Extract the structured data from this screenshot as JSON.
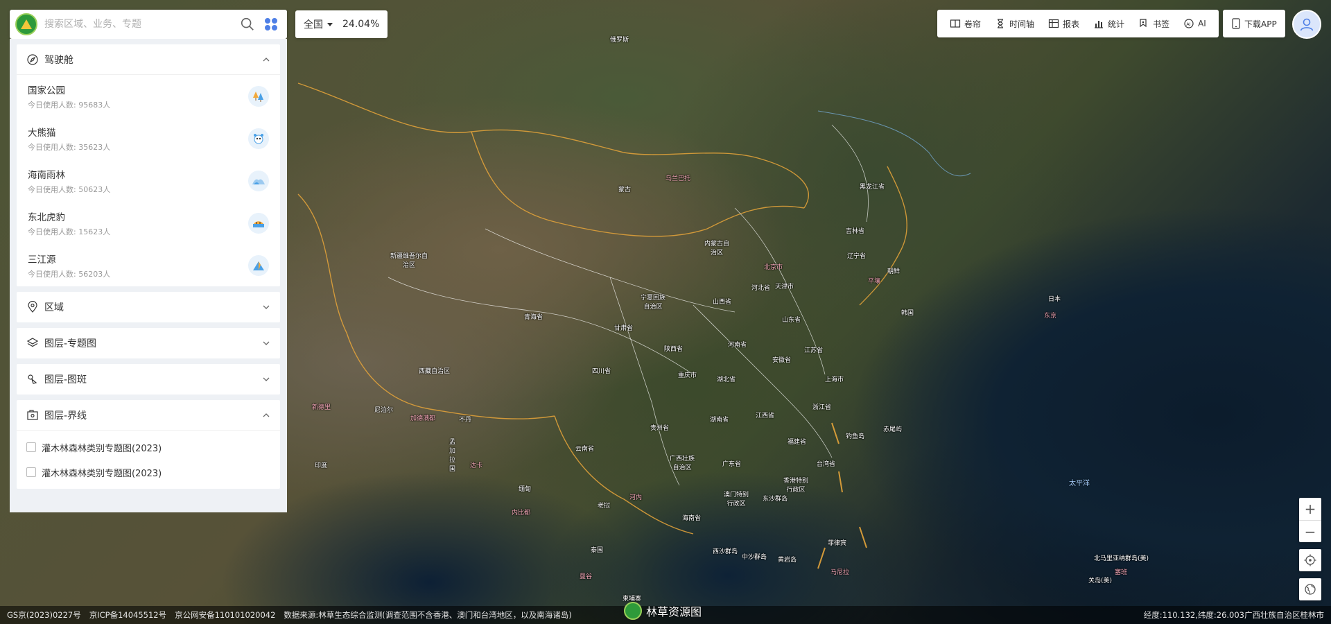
{
  "search": {
    "placeholder": "搜索区域、业务、专题"
  },
  "region_selector": {
    "value": "全国",
    "coverage": "24.04%"
  },
  "toolbar": {
    "items": [
      {
        "label": "卷帘",
        "icon": "split-screen-icon"
      },
      {
        "label": "时间轴",
        "icon": "hourglass-icon"
      },
      {
        "label": "报表",
        "icon": "table-icon"
      },
      {
        "label": "统计",
        "icon": "bar-chart-icon"
      },
      {
        "label": "书签",
        "icon": "bookmark-pin-icon"
      },
      {
        "label": "AI",
        "icon": "ai-icon"
      }
    ],
    "download_label": "下载APP"
  },
  "panel": {
    "cockpit": {
      "title": "驾驶舱",
      "items": [
        {
          "title": "国家公园",
          "sub": "今日使用人数: 95683人"
        },
        {
          "title": "大熊猫",
          "sub": "今日使用人数: 35623人"
        },
        {
          "title": "海南雨林",
          "sub": "今日使用人数: 50623人"
        },
        {
          "title": "东北虎豹",
          "sub": "今日使用人数: 15623人"
        },
        {
          "title": "三江源",
          "sub": "今日使用人数: 56203人"
        }
      ]
    },
    "region": {
      "title": "区域"
    },
    "layer_theme": {
      "title": "图层-专题图"
    },
    "layer_patch": {
      "title": "图层-图斑"
    },
    "layer_boundary": {
      "title": "图层-界线",
      "items": [
        {
          "label": "灌木林森林类别专题图(2023)"
        },
        {
          "label": "灌木林森林类别专题图(2023)"
        }
      ]
    }
  },
  "map_labels": [
    {
      "text": "俄罗斯",
      "pink": false
    },
    {
      "text": "蒙古",
      "pink": false
    },
    {
      "text": "乌兰巴托",
      "pink": true
    },
    {
      "text": "黑龙江省",
      "pink": false
    },
    {
      "text": "吉林省",
      "pink": false
    },
    {
      "text": "辽宁省",
      "pink": false
    },
    {
      "text": "朝鲜",
      "pink": false
    },
    {
      "text": "平壤",
      "pink": true
    },
    {
      "text": "韩国",
      "pink": false
    },
    {
      "text": "日本",
      "pink": false
    },
    {
      "text": "东京",
      "pink": true
    },
    {
      "text": "内蒙古自治区",
      "pink": false
    },
    {
      "text": "北京市",
      "pink": true
    },
    {
      "text": "天津市",
      "pink": false
    },
    {
      "text": "河北省",
      "pink": false
    },
    {
      "text": "山西省",
      "pink": false
    },
    {
      "text": "山东省",
      "pink": false
    },
    {
      "text": "宁夏回族自治区",
      "pink": false
    },
    {
      "text": "新疆维吾尔自治区",
      "pink": false
    },
    {
      "text": "青海省",
      "pink": false
    },
    {
      "text": "甘肃省",
      "pink": false
    },
    {
      "text": "陕西省",
      "pink": false
    },
    {
      "text": "河南省",
      "pink": false
    },
    {
      "text": "江苏省",
      "pink": false
    },
    {
      "text": "安徽省",
      "pink": false
    },
    {
      "text": "上海市",
      "pink": false
    },
    {
      "text": "西藏自治区",
      "pink": false
    },
    {
      "text": "四川省",
      "pink": false
    },
    {
      "text": "重庆市",
      "pink": false
    },
    {
      "text": "湖北省",
      "pink": false
    },
    {
      "text": "浙江省",
      "pink": false
    },
    {
      "text": "湖南省",
      "pink": false
    },
    {
      "text": "江西省",
      "pink": false
    },
    {
      "text": "贵州省",
      "pink": false
    },
    {
      "text": "福建省",
      "pink": false
    },
    {
      "text": "云南省",
      "pink": false
    },
    {
      "text": "广西壮族自治区",
      "pink": false
    },
    {
      "text": "广东省",
      "pink": false
    },
    {
      "text": "台湾省",
      "pink": false
    },
    {
      "text": "香港特别行政区",
      "pink": false
    },
    {
      "text": "澳门特别行政区",
      "pink": false
    },
    {
      "text": "海南省",
      "pink": false
    },
    {
      "text": "尼泊尔",
      "pink": false
    },
    {
      "text": "加德满都",
      "pink": true
    },
    {
      "text": "不丹",
      "pink": false
    },
    {
      "text": "印度",
      "pink": false
    },
    {
      "text": "缅甸",
      "pink": false
    },
    {
      "text": "内比都",
      "pink": true
    },
    {
      "text": "老挝",
      "pink": false
    },
    {
      "text": "河内",
      "pink": true
    },
    {
      "text": "泰国",
      "pink": false
    },
    {
      "text": "曼谷",
      "pink": true
    },
    {
      "text": "柬埔寨",
      "pink": false
    },
    {
      "text": "菲律宾",
      "pink": false
    },
    {
      "text": "马尼拉",
      "pink": true
    },
    {
      "text": "东沙群岛",
      "pink": false
    },
    {
      "text": "西沙群岛",
      "pink": false
    },
    {
      "text": "中沙群岛",
      "pink": false
    },
    {
      "text": "黄岩岛",
      "pink": false
    },
    {
      "text": "钓鱼岛",
      "pink": false
    },
    {
      "text": "赤尾屿",
      "pink": false
    },
    {
      "text": "太平洋",
      "pink": false
    },
    {
      "text": "北马里亚纳群岛(美)",
      "pink": false
    },
    {
      "text": "塞班",
      "pink": true
    },
    {
      "text": "关岛(美)",
      "pink": false
    },
    {
      "text": "新德里",
      "pink": true
    },
    {
      "text": "孟加拉国",
      "pink": false
    },
    {
      "text": "达卡",
      "pink": true
    }
  ],
  "footer": {
    "items": [
      "GS京(2023)0227号",
      "京ICP备14045512号",
      "京公网安备110101020042",
      "数据来源:林草生态综合监测(调查范围不含香港、澳门和台湾地区，以及南海诸岛)"
    ],
    "brand": "林草资源图",
    "coords": "经度:110.132,纬度:26.003广西壮族自治区桂林市"
  },
  "colors": {
    "accent": "#4e7fe6",
    "brand_green": "#2e9a3a",
    "boundary_yellow": "#e6a53a"
  }
}
